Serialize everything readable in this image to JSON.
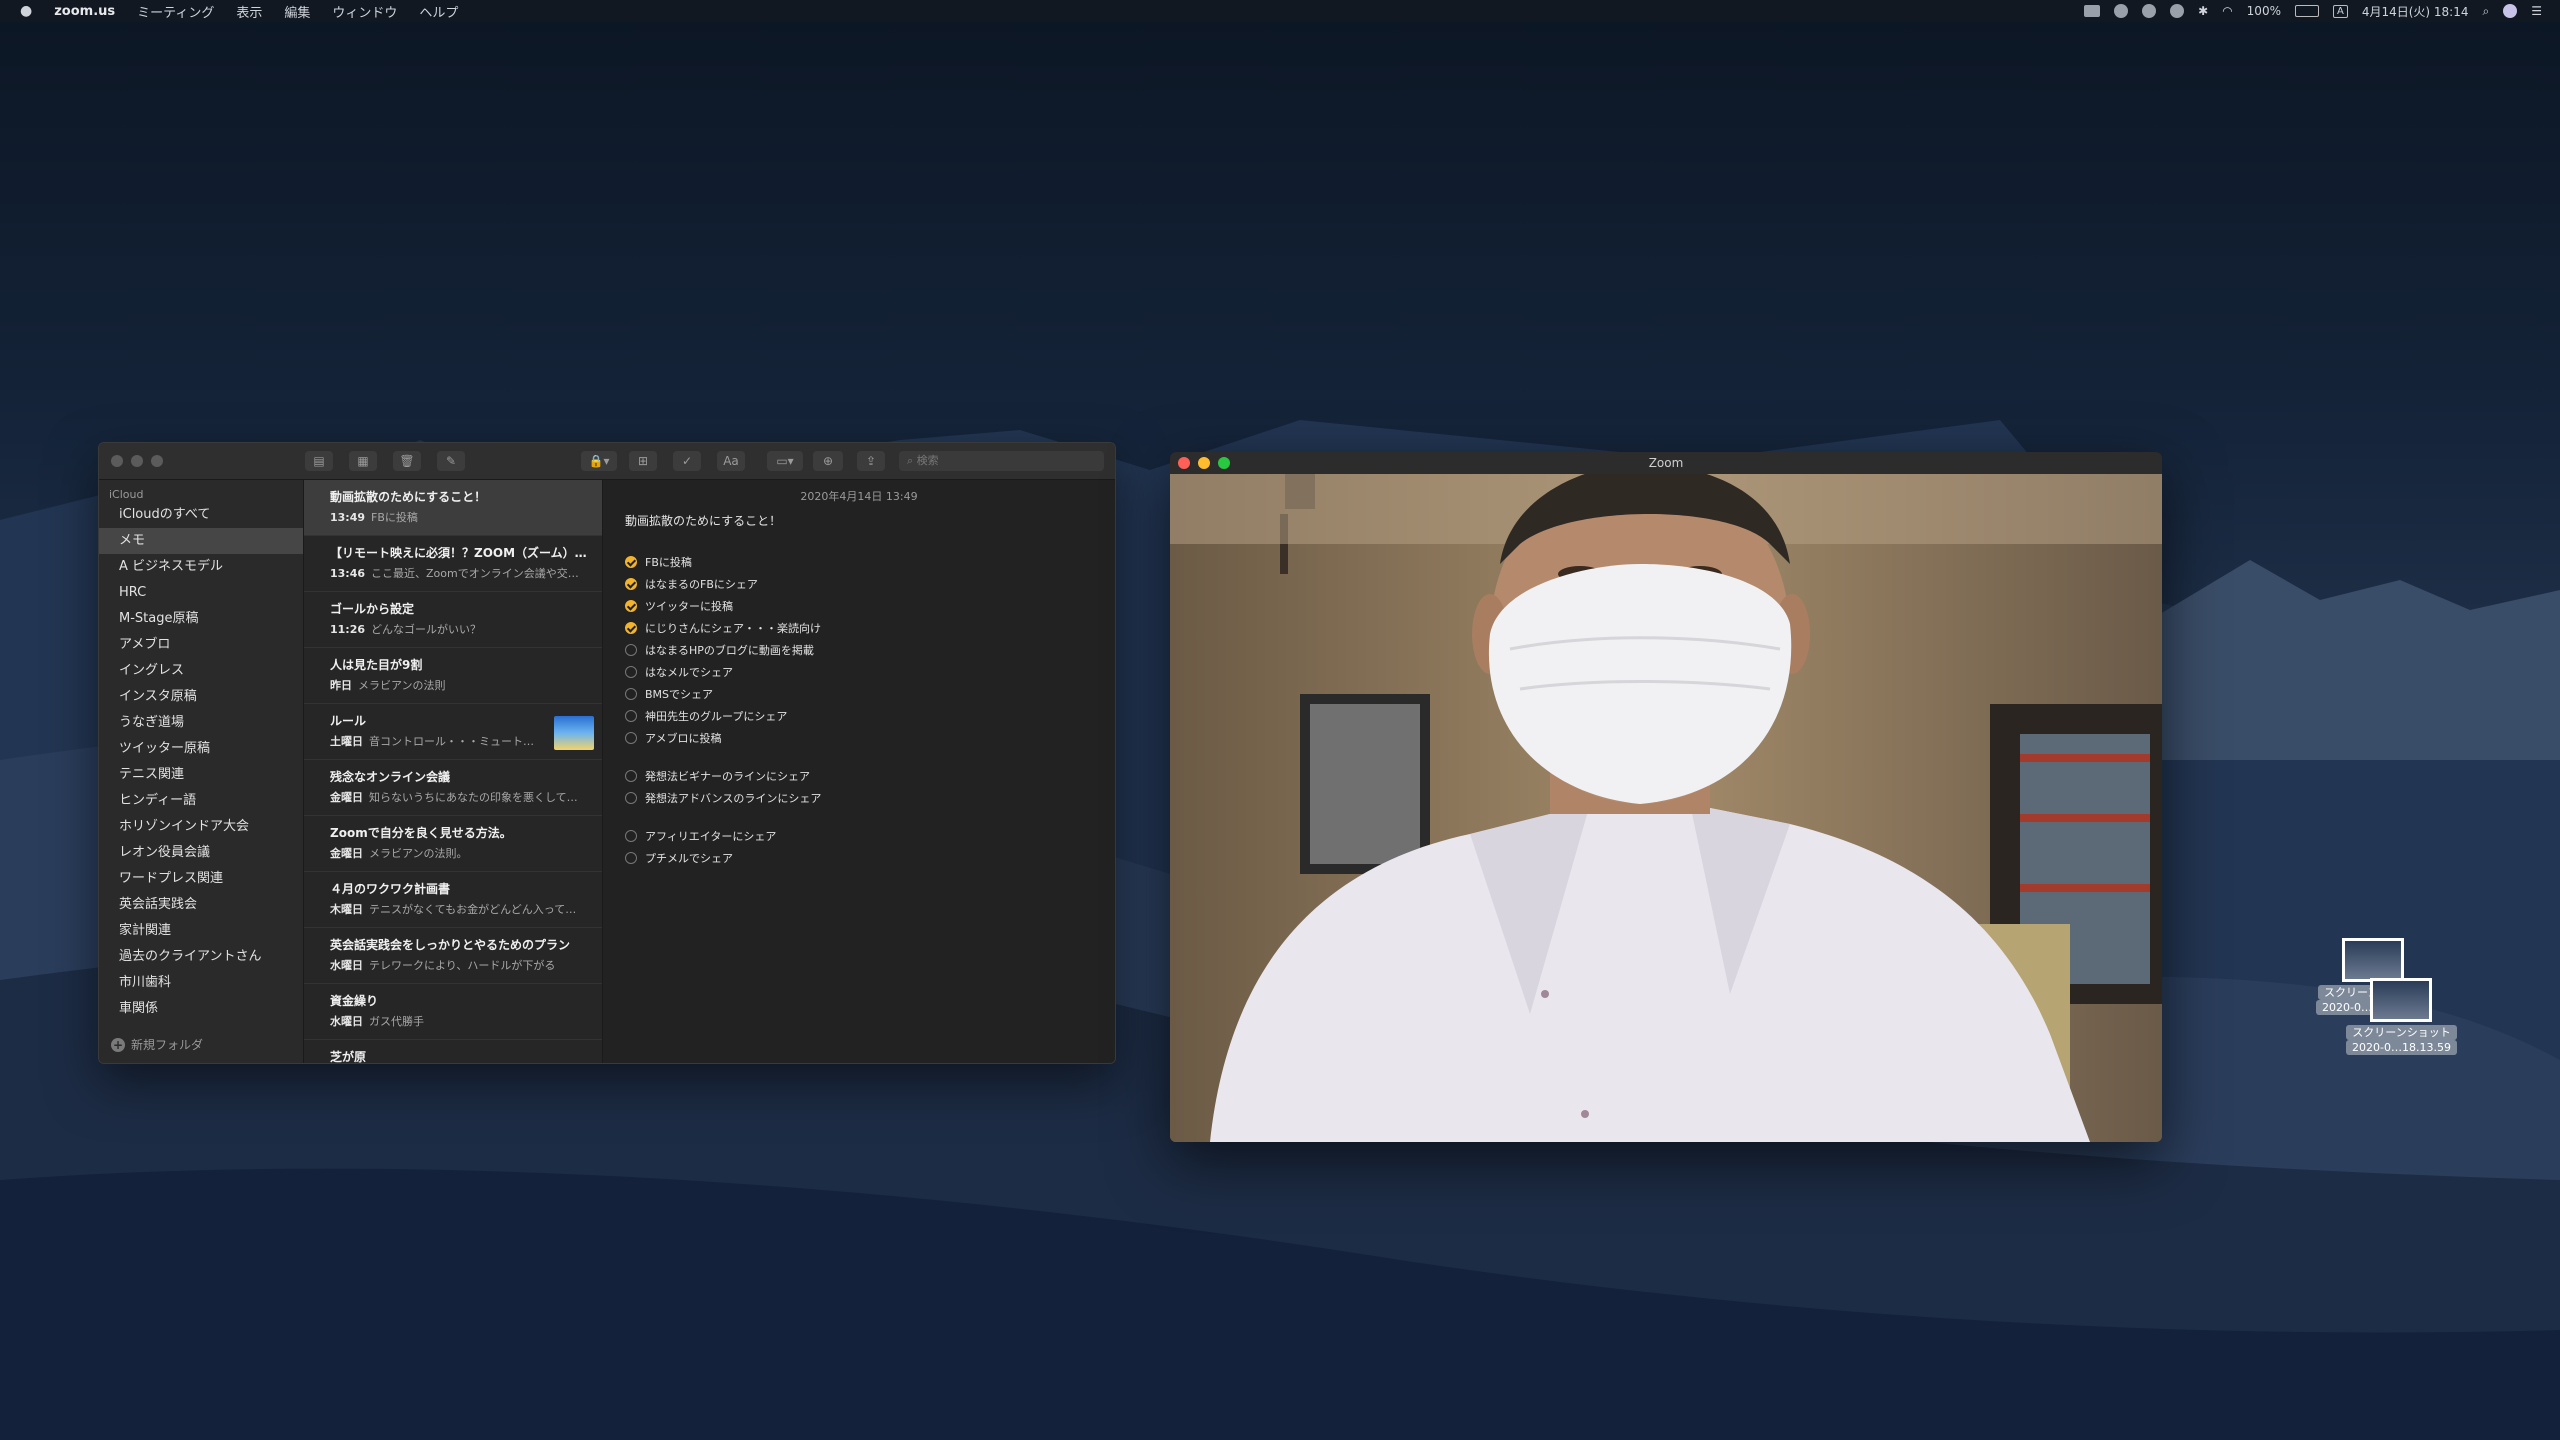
{
  "menubar": {
    "apple": "",
    "app": "zoom.us",
    "menus": [
      "ミーティング",
      "表示",
      "編集",
      "ウィンドウ",
      "ヘルプ"
    ],
    "battery": "100%",
    "input": "A",
    "datetime": "4月14日(火) 18:14"
  },
  "notes": {
    "toolbar": {
      "search_placeholder": "検索",
      "format_label": "Aa"
    },
    "account": "iCloud",
    "folders": [
      "iCloudのすべて",
      "メモ",
      "A ビジネスモデル",
      "HRC",
      "M-Stage原稿",
      "アメブロ",
      "イングレス",
      "インスタ原稿",
      "うなぎ道場",
      "ツイッター原稿",
      "テニス関連",
      "ヒンディー語",
      "ホリゾンインドア大会",
      "レオン役員会議",
      "ワードプレス関連",
      "英会話実践会",
      "家計関連",
      "過去のクライアントさん",
      "市川歯科",
      "車関係"
    ],
    "selected_folder": "メモ",
    "new_folder": "新規フォルダ",
    "list": [
      {
        "title": "動画拡散のためにすること！",
        "time": "13:49",
        "preview": "FBに投稿"
      },
      {
        "title": "【リモート映えに必須！？ZOOM（ズーム）…",
        "time": "13:46",
        "preview": "ここ最近、Zoomでオンライン会議や交…"
      },
      {
        "title": "ゴールから設定",
        "time": "11:26",
        "preview": "どんなゴールがいい？"
      },
      {
        "title": "人は見た目が9割",
        "time": "昨日",
        "preview": "メラビアンの法則"
      },
      {
        "title": "ルール",
        "time": "土曜日",
        "preview": "音コントロール・・・ミュート…"
      },
      {
        "title": "残念なオンライン会議",
        "time": "金曜日",
        "preview": "知らないうちにあなたの印象を悪くして…"
      },
      {
        "title": "Zoomで自分を良く見せる方法。",
        "time": "金曜日",
        "preview": "メラビアンの法則。"
      },
      {
        "title": "４月のワクワク計画書",
        "time": "木曜日",
        "preview": "テニスがなくてもお金がどんどん入って…"
      },
      {
        "title": "英会話実践会をしっかりとやるためのプラン",
        "time": "水曜日",
        "preview": "テレワークにより、ハードルが下がる"
      },
      {
        "title": "資金繰り",
        "time": "水曜日",
        "preview": "ガス代勝手"
      },
      {
        "title": "芝が原",
        "time": "",
        "preview": ""
      }
    ],
    "editor": {
      "date": "2020年4月14日 13:49",
      "title": "動画拡散のためにすること！",
      "group1": [
        {
          "text": "FBに投稿",
          "done": true
        },
        {
          "text": "はなまるのFBにシェア",
          "done": true
        },
        {
          "text": "ツイッターに投稿",
          "done": true
        },
        {
          "text": "にじりさんにシェア・・・楽読向け",
          "done": true
        },
        {
          "text": "はなまるHPのブログに動画を掲載",
          "done": false
        },
        {
          "text": "はなメルでシェア",
          "done": false
        },
        {
          "text": "BMSでシェア",
          "done": false
        },
        {
          "text": "神田先生のグループにシェア",
          "done": false
        },
        {
          "text": "アメブロに投稿",
          "done": false
        }
      ],
      "group2": [
        {
          "text": "発想法ビギナーのラインにシェア",
          "done": false
        },
        {
          "text": "発想法アドバンスのラインにシェア",
          "done": false
        }
      ],
      "group3": [
        {
          "text": "アフィリエイターにシェア",
          "done": false
        },
        {
          "text": "プチメルでシェア",
          "done": false
        }
      ]
    }
  },
  "zoom": {
    "title": "Zoom"
  },
  "desktop": {
    "icons": [
      {
        "label1": "スクリーンショット",
        "label2": "2020-0…8.13.59 2"
      },
      {
        "label1": "スクリーンショット",
        "label2": "2020-0…18.13.59"
      }
    ]
  }
}
